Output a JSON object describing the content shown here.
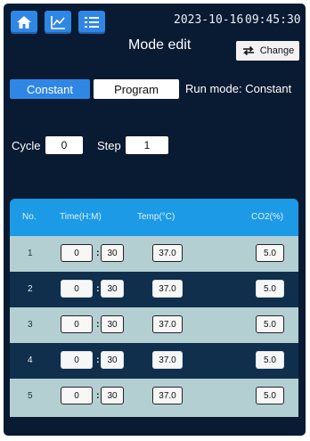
{
  "header": {
    "date": "2023-10-16",
    "time": "09:45:30",
    "title": "Mode edit",
    "change_label": "Change",
    "nav_icons": [
      "home-icon",
      "chart-icon",
      "list-icon"
    ]
  },
  "mode": {
    "constant_label": "Constant",
    "program_label": "Program",
    "run_mode_text": "Run mode: Constant"
  },
  "counters": {
    "cycle_label": "Cycle",
    "cycle_value": "0",
    "step_label": "Step",
    "step_value": "1"
  },
  "table": {
    "headers": {
      "no": "No.",
      "time": "Time(H:M)",
      "temp": "Temp(°C)",
      "co2": "CO2(%)"
    },
    "rows": [
      {
        "no": "1",
        "hours": "0",
        "minutes": "30",
        "temp": "37.0",
        "co2": "5.0"
      },
      {
        "no": "2",
        "hours": "0",
        "minutes": "30",
        "temp": "37.0",
        "co2": "5.0"
      },
      {
        "no": "3",
        "hours": "0",
        "minutes": "30",
        "temp": "37.0",
        "co2": "5.0"
      },
      {
        "no": "4",
        "hours": "0",
        "minutes": "30",
        "temp": "37.0",
        "co2": "5.0"
      },
      {
        "no": "5",
        "hours": "0",
        "minutes": "30",
        "temp": "37.0",
        "co2": "5.0"
      }
    ]
  },
  "colors": {
    "background": "#091a33",
    "accent": "#2f86e4",
    "table_header": "#1c9ae6",
    "row_light": "#b4cfd2",
    "row_dark": "#0f2f4c"
  }
}
